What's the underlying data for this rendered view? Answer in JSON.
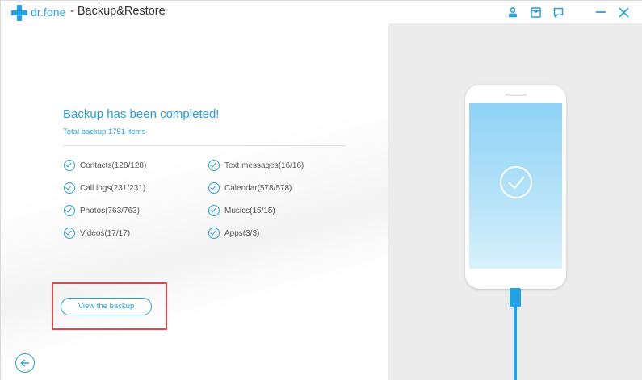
{
  "window": {
    "brand": "dr.fone",
    "title": "- Backup&Restore",
    "toolbar_icons": [
      "user-icon",
      "shop-icon",
      "feedback-icon",
      "minimize-icon",
      "close-icon"
    ]
  },
  "result": {
    "headline": "Backup has been completed!",
    "summary": "Total backup 1751 items",
    "items": [
      {
        "label": "Contacts(128/128)"
      },
      {
        "label": "Text messages(16/16)"
      },
      {
        "label": "Call logs(231/231)"
      },
      {
        "label": "Calendar(578/578)"
      },
      {
        "label": "Photos(763/763)"
      },
      {
        "label": "Musics(15/15)"
      },
      {
        "label": "Videos(17/17)"
      },
      {
        "label": "Apps(3/3)"
      }
    ],
    "view_button": "View the backup"
  },
  "colors": {
    "accent": "#2a9fd8",
    "highlight": "#e04646",
    "right_panel": "#ececec"
  }
}
